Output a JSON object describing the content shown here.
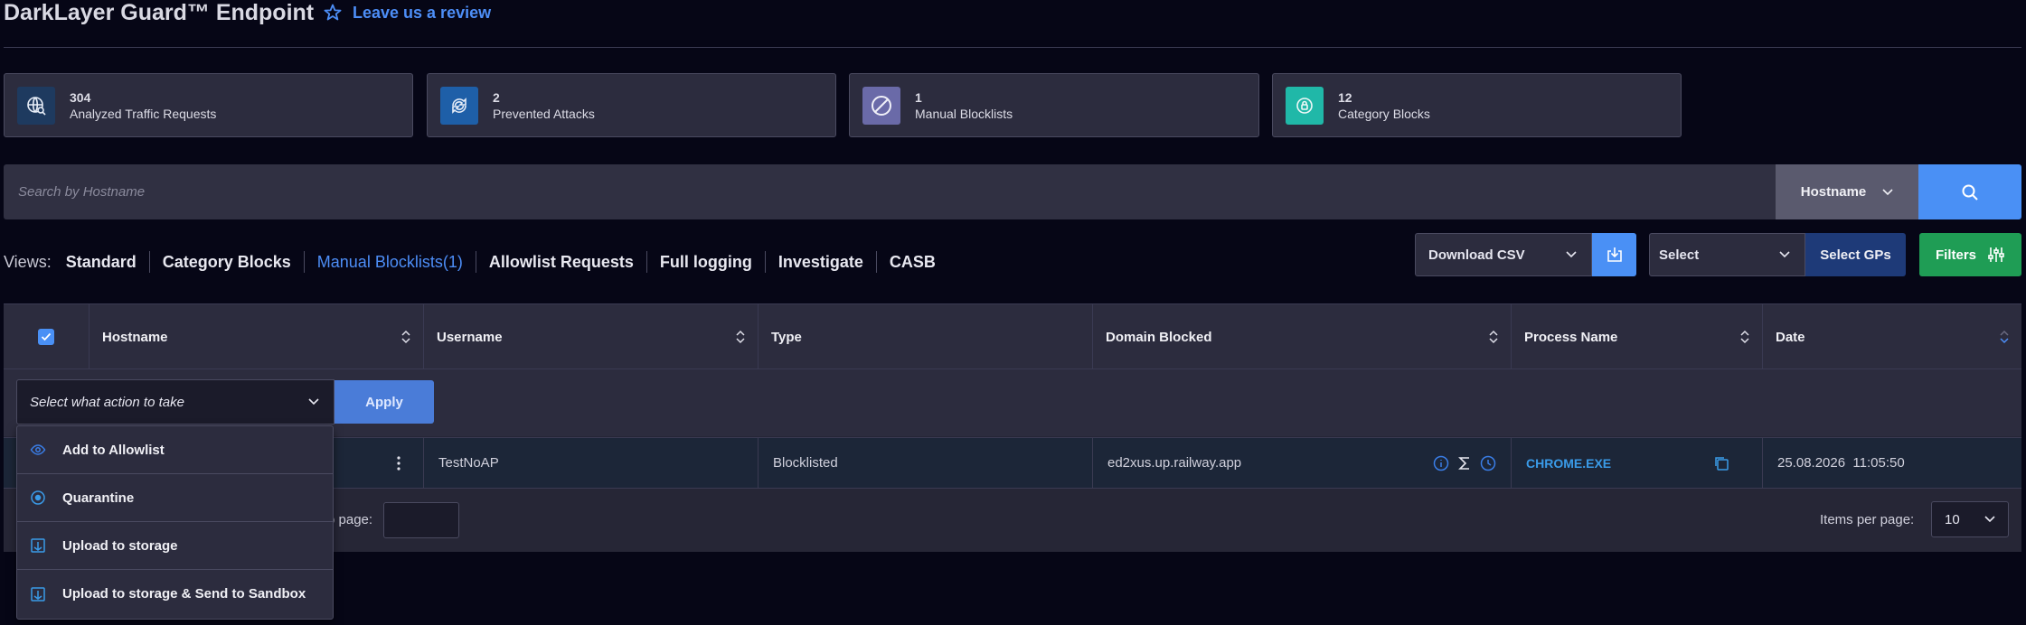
{
  "header": {
    "title": "DarkLayer Guard™ Endpoint",
    "review_link": "Leave us a review"
  },
  "stats": [
    {
      "value": "304",
      "label": "Analyzed Traffic Requests",
      "icon": "globe-search-icon",
      "color": "#1e3a5f"
    },
    {
      "value": "2",
      "label": "Prevented Attacks",
      "icon": "shield-refresh-icon",
      "color": "#1e5fa8"
    },
    {
      "value": "1",
      "label": "Manual Blocklists",
      "icon": "block-icon",
      "color": "#6a6aa8"
    },
    {
      "value": "12",
      "label": "Category Blocks",
      "icon": "lock-badge-icon",
      "color": "#20b8a8"
    }
  ],
  "search": {
    "placeholder": "Search by Hostname",
    "type_label": "Hostname"
  },
  "views": {
    "label": "Views:",
    "tabs": [
      "Standard",
      "Category Blocks",
      "Manual Blocklists(1)",
      "Allowlist Requests",
      "Full logging",
      "Investigate",
      "CASB"
    ],
    "active_index": 2
  },
  "toolbar": {
    "csv_label": "Download CSV",
    "gp_select_label": "Select",
    "gp_button_label": "Select GPs",
    "filters_label": "Filters"
  },
  "table": {
    "columns": [
      "Hostname",
      "Username",
      "Type",
      "Domain Blocked",
      "Process Name",
      "Date"
    ],
    "action_placeholder": "Select what action to take",
    "apply_label": "Apply",
    "rows": [
      {
        "hostname": "",
        "username": "TestNoAP",
        "type": "Blocklisted",
        "domain": "ed2xus.up.railway.app",
        "process": "CHROME.EXE",
        "date": "25.08.2026  11:05:50"
      }
    ]
  },
  "pager": {
    "goto_label": "o page:",
    "items_per_page_label": "Items per page:",
    "items_per_page_value": "10"
  },
  "action_menu": [
    {
      "label": "Add to Allowlist",
      "icon": "eye-icon"
    },
    {
      "label": "Quarantine",
      "icon": "target-icon"
    },
    {
      "label": "Upload to storage",
      "icon": "upload-icon"
    },
    {
      "label": "Upload to storage & Send to Sandbox",
      "icon": "upload-icon"
    }
  ],
  "colors": {
    "accent": "#4a90f5",
    "success": "#1f9d55",
    "background": "#060616"
  }
}
